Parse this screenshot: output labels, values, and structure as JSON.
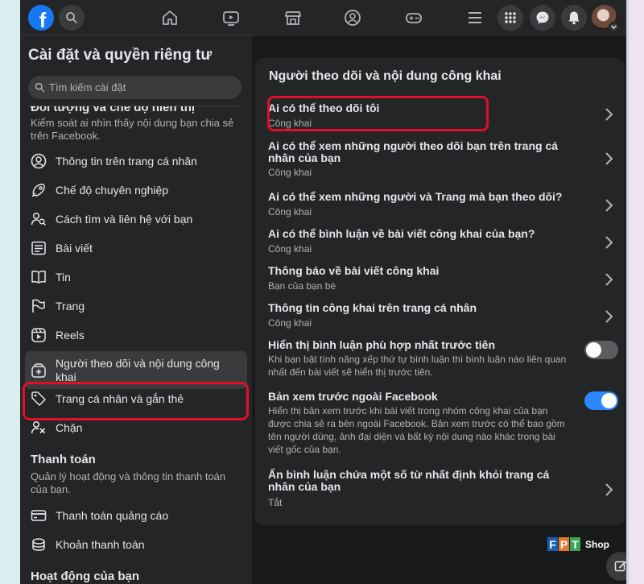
{
  "nav": {
    "logo_letter": "f",
    "icons": [
      "search-icon",
      "home-icon",
      "watch-icon",
      "marketplace-icon",
      "groups-icon",
      "gaming-icon",
      "menu-lines-icon",
      "apps-grid-icon",
      "messenger-icon",
      "notifications-icon",
      "account-avatar"
    ]
  },
  "sidebar": {
    "title": "Cài đặt và quyền riêng tư",
    "search_placeholder": "Tìm kiếm cài đặt",
    "section1": {
      "heading": "Đối tượng và chế độ hiển thị",
      "description": "Kiểm soát ai nhìn thấy nội dung bạn chia sẻ trên Facebook."
    },
    "items": [
      {
        "label": "Thông tin trên trang cá nhân",
        "icon": "profile-icon"
      },
      {
        "label": "Chế độ chuyên nghiệp",
        "icon": "professional-mode-icon"
      },
      {
        "label": "Cách tìm và liên hệ với bạn",
        "icon": "person-search-icon"
      },
      {
        "label": "Bài viết",
        "icon": "posts-icon"
      },
      {
        "label": "Tin",
        "icon": "stories-icon"
      },
      {
        "label": "Trang",
        "icon": "pages-flag-icon"
      },
      {
        "label": "Reels",
        "icon": "reels-icon"
      },
      {
        "label": "Người theo dõi và nội dung công khai",
        "icon": "followers-public-icon"
      },
      {
        "label": "Trang cá nhân và gắn thẻ",
        "icon": "tag-icon"
      },
      {
        "label": "Chặn",
        "icon": "block-user-icon"
      }
    ],
    "section2": {
      "heading": "Thanh toán",
      "description": "Quản lý hoạt động và thông tin thanh toán của bạn."
    },
    "payments": [
      {
        "label": "Thanh toán quảng cáo",
        "icon": "ad-payments-icon"
      },
      {
        "label": "Khoản thanh toán",
        "icon": "payouts-icon"
      }
    ],
    "section3": {
      "heading": "Hoạt động của bạn"
    }
  },
  "main": {
    "panel_title": "Người theo dõi và nội dung công khai",
    "rows": [
      {
        "title": "Ai có thể theo dõi tôi",
        "sub": "Công khai"
      },
      {
        "title": "Ai có thể xem những người theo dõi bạn trên trang cá nhân của bạn",
        "sub": "Công khai"
      },
      {
        "title": "Ai có thể xem những người và Trang mà bạn theo dõi?",
        "sub": "Công khai"
      },
      {
        "title": "Ai có thể bình luận về bài viết công khai của bạn?",
        "sub": "Công khai"
      },
      {
        "title": "Thông báo về bài viết công khai",
        "sub": "Bạn của bạn bè"
      },
      {
        "title": "Thông tin công khai trên trang cá nhân",
        "sub": "Công khai"
      }
    ],
    "toggles": [
      {
        "title": "Hiển thị bình luận phù hợp nhất trước tiên",
        "sub": "Khi bạn bật tính năng xếp thứ tự bình luận thì bình luận nào liên quan nhất đến bài viết sẽ hiển thị trước tiên.",
        "on": false
      },
      {
        "title": "Bản xem trước ngoài Facebook",
        "sub": "Hiển thị bản xem trước khi bài viết trong nhóm công khai của bạn được chia sẻ ra bên ngoài Facebook. Bản xem trước có thể bao gồm tên người dùng, ảnh đại diện và bất kỳ nội dung nào khác trong bài viết gốc của bạn.",
        "on": true
      }
    ],
    "last_row": {
      "title": "Ẩn bình luận chứa một số từ nhất định khỏi trang cá nhân của bạn",
      "sub": "Tắt"
    }
  },
  "watermark": {
    "letters": [
      "F",
      "P",
      "T"
    ],
    "shop": "Shop"
  },
  "colors": {
    "accent": "#2d88ff",
    "highlight": "#e0102a",
    "fb_blue": "#1877f2"
  }
}
